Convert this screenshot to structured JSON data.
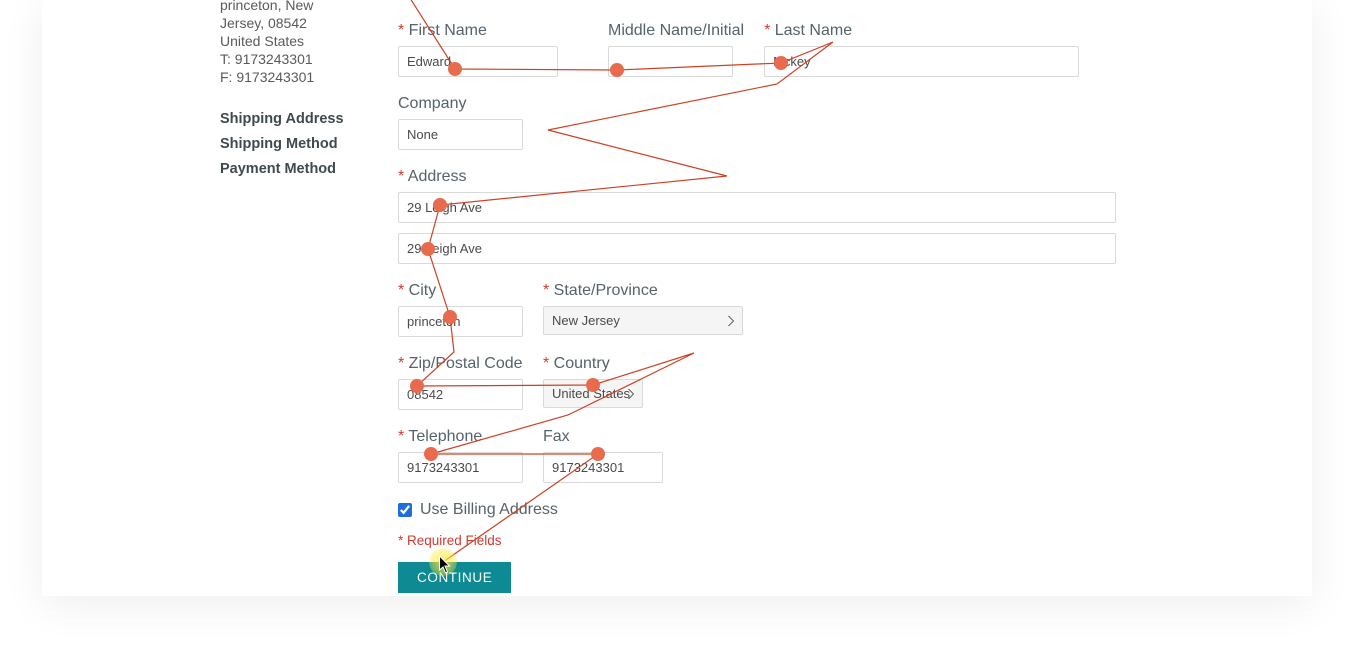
{
  "sidebar": {
    "address_line1": "princeton, New",
    "address_line2": "Jersey, 08542",
    "address_line3": "United States",
    "address_line4": "T: 9173243301",
    "address_line5": "F: 9173243301",
    "links": {
      "shipping_address": "Shipping Address",
      "shipping_method": "Shipping Method",
      "payment_method": "Payment Method"
    }
  },
  "form": {
    "labels": {
      "first_name": "First Name",
      "middle_name": "Middle Name/Initial",
      "last_name": "Last Name",
      "company": "Company",
      "address": "Address",
      "city": "City",
      "state": "State/Province",
      "zip": "Zip/Postal Code",
      "country": "Country",
      "telephone": "Telephone",
      "fax": "Fax",
      "use_billing": "Use Billing Address",
      "required": "* Required Fields",
      "continue": "CONTINUE"
    },
    "values": {
      "first_name": "Edward",
      "middle_name": "",
      "last_name": "Mckey",
      "company": "None",
      "address1": "29 Leigh Ave",
      "address2": "29 Leigh Ave",
      "city": "princeton",
      "state": "New Jersey",
      "zip": "08542",
      "country": "United States",
      "telephone": "9173243301",
      "fax": "9173243301"
    },
    "use_billing_checked": true
  }
}
